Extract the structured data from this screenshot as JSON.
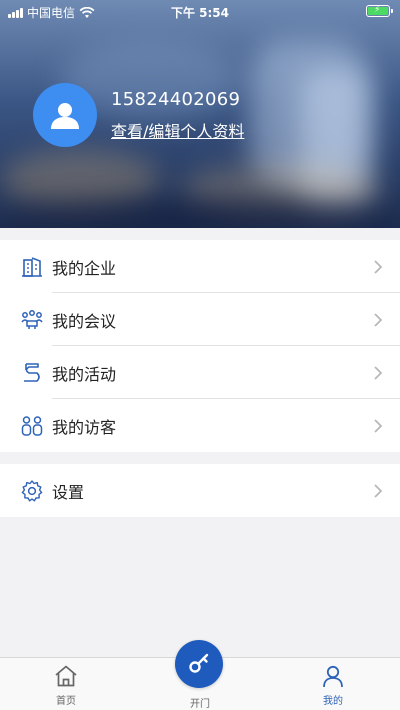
{
  "status_bar": {
    "carrier": "中国电信",
    "time": "下午 5:54"
  },
  "profile": {
    "phone": "15824402069",
    "edit_link": "查看/编辑个人资料"
  },
  "menu": {
    "items": [
      {
        "label": "我的企业",
        "icon": "building-icon"
      },
      {
        "label": "我的会议",
        "icon": "meeting-icon"
      },
      {
        "label": "我的活动",
        "icon": "activity-icon"
      },
      {
        "label": "我的访客",
        "icon": "visitors-icon"
      }
    ]
  },
  "settings": {
    "label": "设置",
    "icon": "gear-icon"
  },
  "tab_bar": {
    "home": "首页",
    "open_door": "开门",
    "mine": "我的"
  },
  "colors": {
    "accent": "#2e63b8",
    "avatar": "#3d8ef0",
    "open_button": "#1e5bbd",
    "battery": "#4cd964"
  }
}
